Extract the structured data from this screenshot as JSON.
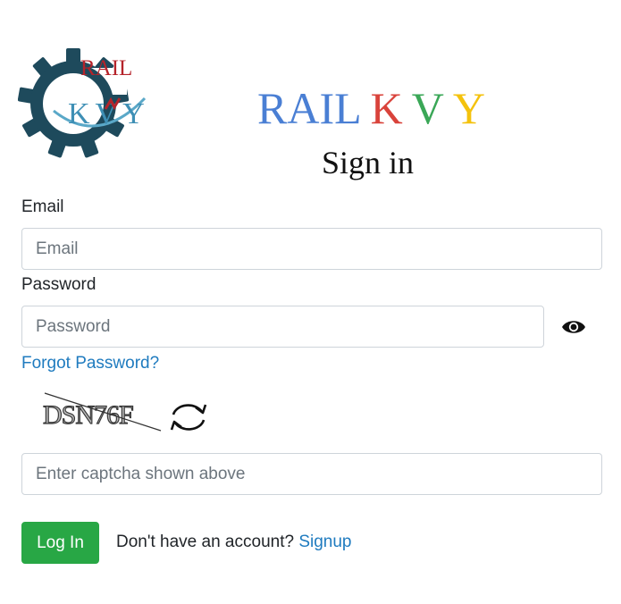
{
  "logo": {
    "top_text": "RAIL",
    "bottom_text": "KVY",
    "gear_color": "#1e4a5c",
    "rail_color": "#b5232a"
  },
  "brand": {
    "word": "RAIL",
    "letters": [
      "K",
      "V",
      "Y"
    ],
    "colors": {
      "word": "#4a7fd4",
      "k": "#d9433b",
      "v": "#3aa757",
      "y": "#f4c20d"
    }
  },
  "heading": "Sign in",
  "email": {
    "label": "Email",
    "placeholder": "Email",
    "value": ""
  },
  "password": {
    "label": "Password",
    "placeholder": "Password",
    "value": ""
  },
  "forgot_password": "Forgot Password?",
  "captcha": {
    "image_text": "DSN76F",
    "input_placeholder": "Enter captcha shown above",
    "value": ""
  },
  "login_button": "Log In",
  "signup": {
    "prompt": "Don't have an account?",
    "link": "Signup"
  },
  "colors": {
    "accent": "#28a745",
    "link": "#1f7bbf"
  }
}
